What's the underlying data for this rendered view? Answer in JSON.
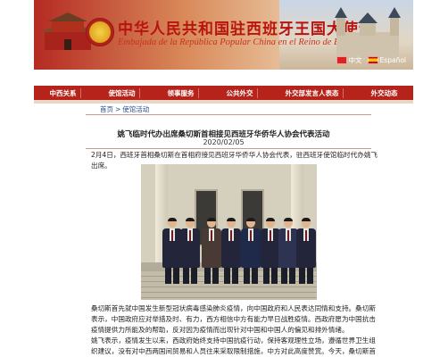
{
  "header": {
    "title_cn": "中华人民共和国驻西班牙王国大使馆",
    "title_es": "Embajada de la República Popular China en el Reino de España",
    "languages": [
      "中文",
      "Español"
    ]
  },
  "nav": {
    "items": [
      "中西关系",
      "使馆活动",
      "领事服务",
      "公共外交",
      "外交部发言人表态",
      "外交动态"
    ]
  },
  "breadcrumb": {
    "home": "首页",
    "separator": ">",
    "current": "使馆活动"
  },
  "article": {
    "title": "姚飞临时代办出席桑切斯首相接见西班牙华侨华人协会代表活动",
    "date": "2020/02/05",
    "paragraph1": "2月4日，西班牙首相桑切斯在首相府接见西班牙华侨华人协会代表，驻西班牙使馆临时代办姚飞出席。",
    "paragraph2": "桑切斯首先就中国发生新型冠状病毒感染肺炎疫情，向中国政府和人民表达同情和支持。桑切斯表示，中国政府应对举措及时、有力，西方相信中方有能力早日战胜疫情。西政府愿为中国抗击疫情提供力所能及的帮助，反对因为疫情而出现针对中国和中国人的偏见和排外情绪。",
    "paragraph3": "姚飞表示，疫情发生以来，西政府始终支持中国抗疫行动，保持客观理性立场，遵循世界卫生组织建议，没有对中西两国间贸易和人员往来采取限制措施，中方对此高度赞赏。今天，桑切斯首相主动接见旅西侨界代表，再次充分表明西方对中方的支持，中方深受感动并深表谢意。"
  },
  "photo": {
    "people_count": 8
  }
}
